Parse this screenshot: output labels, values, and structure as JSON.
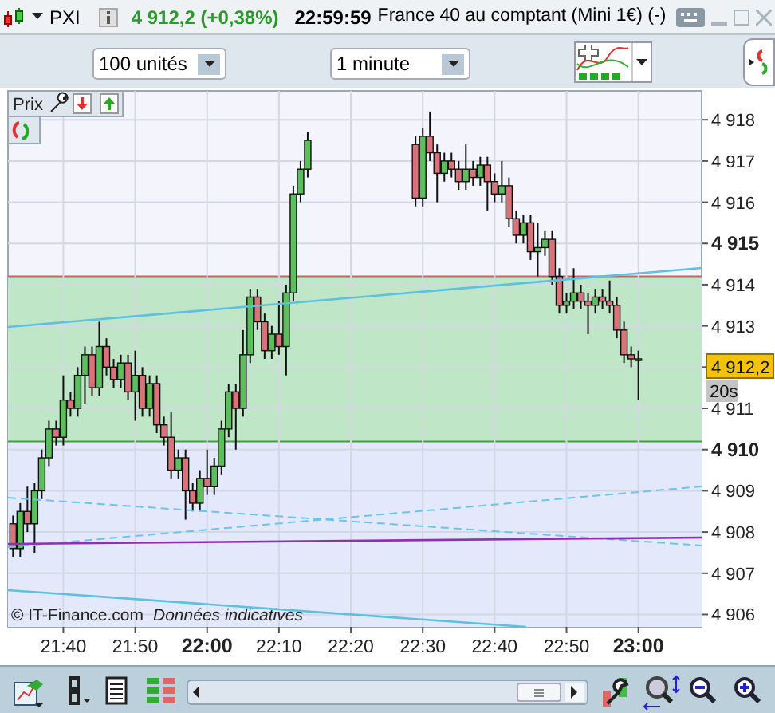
{
  "title_bar": {
    "symbol": "PXI",
    "quote": "4 912,2 (+0,38%)",
    "time": "22:59:59",
    "instrument": "France 40 au comptant (Mini 1€) (-)"
  },
  "toolbar": {
    "quantity": "100 unités",
    "interval": "1 minute"
  },
  "chart": {
    "panel_label": "Prix",
    "price_tag": "4 912,2",
    "countdown": "20s",
    "copyright": "© IT-Finance.com",
    "disclaimer": "Données indicatives",
    "chart_data": {
      "type": "candlestick",
      "grid": true,
      "bands": [
        {
          "axis": "y",
          "from": 4910.2,
          "to": 4914.2,
          "color": "#bfe6c6"
        },
        {
          "axis": "y",
          "from": 4905.7,
          "to": 4910.2,
          "color": "#e3e8fb"
        }
      ],
      "ref_lines": [
        {
          "axis": "y",
          "value": 4914.2,
          "color": "#d06060"
        },
        {
          "axis": "y",
          "value": 4910.2,
          "color": "#40a040"
        }
      ],
      "xlim": [
        1292.3,
        1388.8
      ],
      "ylim": [
        4905.7,
        4918.7
      ],
      "x": [
        1293,
        1294,
        1295,
        1296,
        1297,
        1298,
        1299,
        1300,
        1301,
        1302,
        1303,
        1304,
        1305,
        1306,
        1307,
        1308,
        1309,
        1310,
        1311,
        1312,
        1313,
        1314,
        1315,
        1316,
        1317,
        1318,
        1319,
        1320,
        1321,
        1322,
        1323,
        1324,
        1325,
        1326,
        1327,
        1328,
        1329,
        1330,
        1331,
        1332,
        1333,
        1334,
        1349,
        1350,
        1351,
        1352,
        1353,
        1354,
        1355,
        1356,
        1357,
        1358,
        1359,
        1360,
        1361,
        1362,
        1363,
        1364,
        1365,
        1366,
        1367,
        1368,
        1369,
        1370,
        1371,
        1372,
        1373,
        1374,
        1375,
        1376,
        1377,
        1378,
        1379,
        1380
      ],
      "ohlc": [
        [
          4908.2,
          4908.4,
          4907.4,
          4907.6
        ],
        [
          4907.6,
          4908.7,
          4907.4,
          4908.5
        ],
        [
          4908.5,
          4909.1,
          4908.0,
          4908.2
        ],
        [
          4908.2,
          4909.2,
          4907.5,
          4909.0
        ],
        [
          4909.0,
          4910.0,
          4908.8,
          4909.8
        ],
        [
          4909.8,
          4910.7,
          4909.6,
          4910.5
        ],
        [
          4910.5,
          4910.7,
          4910.1,
          4910.3
        ],
        [
          4910.3,
          4911.8,
          4910.1,
          4911.2
        ],
        [
          4911.2,
          4911.4,
          4910.8,
          4911.0
        ],
        [
          4911.0,
          4912.0,
          4910.8,
          4911.8
        ],
        [
          4911.8,
          4912.5,
          4911.1,
          4912.3
        ],
        [
          4912.3,
          4912.5,
          4911.3,
          4911.5
        ],
        [
          4911.5,
          4913.1,
          4911.3,
          4912.5
        ],
        [
          4912.5,
          4912.7,
          4911.8,
          4912.0
        ],
        [
          4912.0,
          4912.2,
          4911.5,
          4911.7
        ],
        [
          4911.7,
          4912.3,
          4911.5,
          4912.1
        ],
        [
          4912.1,
          4912.3,
          4911.2,
          4911.4
        ],
        [
          4911.4,
          4912.4,
          4910.7,
          4911.8
        ],
        [
          4911.8,
          4912.0,
          4910.8,
          4911.0
        ],
        [
          4911.0,
          4911.8,
          4910.8,
          4911.6
        ],
        [
          4911.6,
          4911.8,
          4910.4,
          4910.6
        ],
        [
          4910.6,
          4910.8,
          4910.1,
          4910.3
        ],
        [
          4910.3,
          4910.9,
          4909.3,
          4909.5
        ],
        [
          4909.5,
          4910.0,
          4909.3,
          4909.8
        ],
        [
          4909.8,
          4910.0,
          4908.3,
          4909.0
        ],
        [
          4909.0,
          4909.2,
          4908.5,
          4908.7
        ],
        [
          4908.7,
          4909.5,
          4908.5,
          4909.3
        ],
        [
          4909.3,
          4910.0,
          4908.9,
          4909.1
        ],
        [
          4909.1,
          4909.8,
          4908.9,
          4909.6
        ],
        [
          4909.6,
          4910.7,
          4909.4,
          4910.5
        ],
        [
          4910.5,
          4911.6,
          4910.3,
          4911.4
        ],
        [
          4911.4,
          4911.6,
          4910.0,
          4911.0
        ],
        [
          4911.0,
          4912.9,
          4910.8,
          4912.3
        ],
        [
          4912.3,
          4913.9,
          4912.1,
          4913.7
        ],
        [
          4913.7,
          4913.9,
          4912.9,
          4913.1
        ],
        [
          4913.1,
          4913.3,
          4912.2,
          4912.4
        ],
        [
          4912.4,
          4913.0,
          4912.2,
          4912.8
        ],
        [
          4912.8,
          4913.6,
          4912.3,
          4912.5
        ],
        [
          4912.5,
          4914.0,
          4911.8,
          4913.8
        ],
        [
          4913.8,
          4916.4,
          4913.6,
          4916.2
        ],
        [
          4916.2,
          4917.0,
          4916.0,
          4916.8
        ],
        [
          4916.8,
          4917.7,
          4916.6,
          4917.5
        ],
        [
          4917.4,
          4917.6,
          4915.9,
          4916.1
        ],
        [
          4916.1,
          4917.8,
          4915.9,
          4917.6
        ],
        [
          4917.6,
          4918.2,
          4917.0,
          4917.2
        ],
        [
          4917.2,
          4917.4,
          4916.0,
          4916.7
        ],
        [
          4916.7,
          4917.2,
          4916.5,
          4917.0
        ],
        [
          4917.0,
          4917.2,
          4916.6,
          4916.8
        ],
        [
          4916.8,
          4917.0,
          4916.3,
          4916.5
        ],
        [
          4916.5,
          4917.4,
          4916.3,
          4916.8
        ],
        [
          4916.8,
          4917.0,
          4916.4,
          4916.6
        ],
        [
          4916.6,
          4917.1,
          4916.4,
          4916.9
        ],
        [
          4916.9,
          4917.1,
          4915.8,
          4916.5
        ],
        [
          4916.5,
          4916.7,
          4916.0,
          4916.2
        ],
        [
          4916.2,
          4917.0,
          4916.0,
          4916.4
        ],
        [
          4916.4,
          4916.6,
          4915.4,
          4915.6
        ],
        [
          4915.6,
          4915.8,
          4915.0,
          4915.2
        ],
        [
          4915.2,
          4915.7,
          4915.0,
          4915.5
        ],
        [
          4915.5,
          4915.7,
          4914.6,
          4914.8
        ],
        [
          4914.8,
          4915.5,
          4914.2,
          4914.9
        ],
        [
          4914.9,
          4915.3,
          4914.7,
          4915.1
        ],
        [
          4915.1,
          4915.3,
          4914.0,
          4914.2
        ],
        [
          4914.2,
          4914.4,
          4913.3,
          4913.5
        ],
        [
          4913.5,
          4913.8,
          4913.3,
          4913.6
        ],
        [
          4913.6,
          4914.4,
          4913.4,
          4913.8
        ],
        [
          4913.8,
          4914.0,
          4913.4,
          4913.6
        ],
        [
          4913.6,
          4913.8,
          4912.8,
          4913.5
        ],
        [
          4913.5,
          4913.9,
          4913.3,
          4913.7
        ],
        [
          4913.7,
          4913.9,
          4913.4,
          4913.6
        ],
        [
          4913.6,
          4914.1,
          4913.3,
          4913.5
        ],
        [
          4913.5,
          4913.7,
          4912.7,
          4912.9
        ],
        [
          4912.9,
          4913.1,
          4912.1,
          4912.3
        ],
        [
          4912.3,
          4912.5,
          4912.0,
          4912.2
        ],
        [
          4912.2,
          4912.4,
          4911.2,
          4912.2
        ]
      ],
      "yticks": [
        {
          "value": 4918,
          "label": "4 918"
        },
        {
          "value": 4917,
          "label": "4 917"
        },
        {
          "value": 4916,
          "label": "4 916"
        },
        {
          "value": 4915,
          "label": "4 915"
        },
        {
          "value": 4914,
          "label": "4 914"
        },
        {
          "value": 4913,
          "label": "4 913"
        },
        {
          "value": 4911,
          "label": "4 911"
        },
        {
          "value": 4910,
          "label": "4 910"
        },
        {
          "value": 4909,
          "label": "4 909"
        },
        {
          "value": 4908,
          "label": "4 908"
        },
        {
          "value": 4907,
          "label": "4 907"
        },
        {
          "value": 4906,
          "label": "4 906"
        }
      ],
      "xticks": [
        {
          "value": 1300,
          "label": "21:40"
        },
        {
          "value": 1310,
          "label": "21:50"
        },
        {
          "value": 1320,
          "label": "22:00"
        },
        {
          "value": 1330,
          "label": "22:10"
        },
        {
          "value": 1340,
          "label": "22:20"
        },
        {
          "value": 1350,
          "label": "22:30"
        },
        {
          "value": 1360,
          "label": "22:40"
        },
        {
          "value": 1370,
          "label": "22:50"
        },
        {
          "value": 1380,
          "label": "23:00"
        }
      ]
    }
  }
}
